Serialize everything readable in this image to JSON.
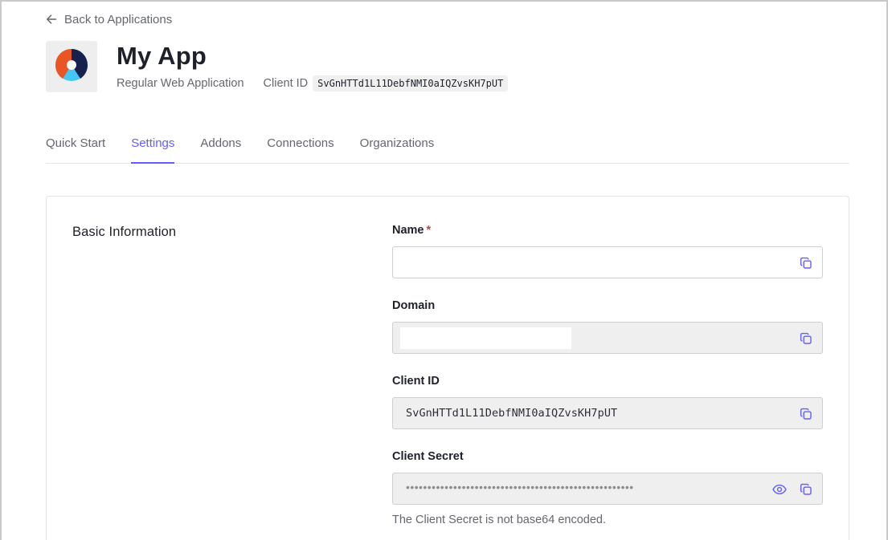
{
  "nav": {
    "back_label": "Back to Applications"
  },
  "app": {
    "name": "My App",
    "type": "Regular Web Application",
    "client_id_label": "Client ID",
    "client_id": "SvGnHTTd1L11DebfNMI0aIQZvsKH7pUT"
  },
  "tabs": [
    {
      "label": "Quick Start"
    },
    {
      "label": "Settings",
      "active": true
    },
    {
      "label": "Addons"
    },
    {
      "label": "Connections"
    },
    {
      "label": "Organizations"
    }
  ],
  "settings": {
    "section_title": "Basic Information",
    "name": {
      "label": "Name",
      "required_mark": "*",
      "value": ""
    },
    "domain": {
      "label": "Domain",
      "value": ""
    },
    "client_id": {
      "label": "Client ID",
      "value": "SvGnHTTd1L11DebfNMI0aIQZvsKH7pUT"
    },
    "client_secret": {
      "label": "Client Secret",
      "masked_value": "•••••••••••••••••••••••••••••••••••••••••••••••••••••",
      "helper": "The Client Secret is not base64 encoded."
    }
  },
  "icons": {
    "copy": "copy-icon",
    "reveal": "eye-icon",
    "back": "arrow-left-icon",
    "logo": "app-logo-icon"
  },
  "colors": {
    "accent": "#635dff",
    "required": "#e0393e",
    "logo_orange": "#eb5424",
    "logo_navy": "#16214d",
    "logo_cyan": "#44c7f4"
  }
}
